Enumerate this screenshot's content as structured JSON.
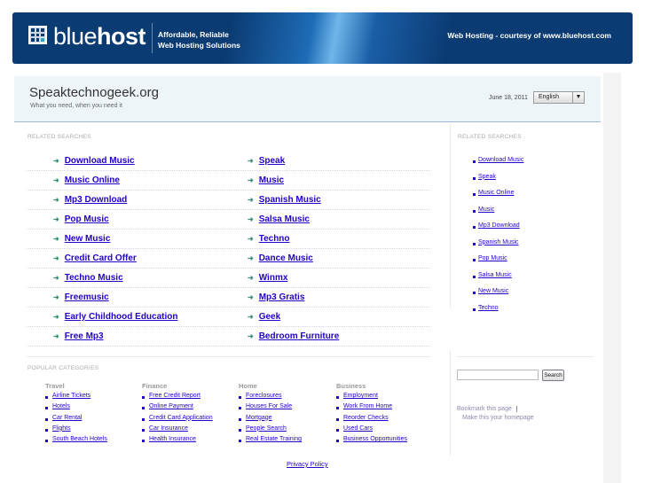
{
  "banner": {
    "logo_light": "blue",
    "logo_bold": "host",
    "tagline_1": "Affordable, Reliable",
    "tagline_2": "Web Hosting Solutions",
    "courtesy": "Web Hosting - courtesy of www.bluehost.com"
  },
  "header": {
    "title": "Speaktechnogeek.org",
    "subtitle": "What you need, when you need it",
    "date": "June 18, 2011",
    "language": "English"
  },
  "related": {
    "label": "RELATED SEARCHES",
    "left": [
      "Download Music",
      "Music Online",
      "Mp3 Download",
      "Pop Music",
      "New Music",
      "Credit Card Offer",
      "Techno Music",
      "Freemusic",
      "Early Childhood Education",
      "Free Mp3"
    ],
    "right": [
      "Speak",
      "Music",
      "Spanish Music",
      "Salsa Music",
      "Techno",
      "Dance Music",
      "Winmx",
      "Mp3 Gratis",
      "Geek",
      "Bedroom Furniture"
    ]
  },
  "sidebar": {
    "label": "RELATED SEARCHES",
    "items": [
      "Download Music",
      "Speak",
      "Music Online",
      "Music",
      "Mp3 Download",
      "Spanish Music",
      "Pop Music",
      "Salsa Music",
      "New Music",
      "Techno"
    ],
    "search_button": "Search",
    "search_value": "",
    "bookmark": "Bookmark this page",
    "homepage": "Make this your homepage"
  },
  "popular": {
    "label": "POPULAR CATEGORIES",
    "columns": [
      {
        "title": "Travel",
        "items": [
          "Airline Tickets",
          "Hotels",
          "Car Rental",
          "Flights",
          "South Beach Hotels"
        ]
      },
      {
        "title": "Finance",
        "items": [
          "Free Credit Report",
          "Online Payment",
          "Credit Card Application",
          "Car Insurance",
          "Health Insurance"
        ]
      },
      {
        "title": "Home",
        "items": [
          "Foreclosures",
          "Houses For Sale",
          "Mortgage",
          "People Search",
          "Real Estate Training"
        ]
      },
      {
        "title": "Business",
        "items": [
          "Employment",
          "Work From Home",
          "Reorder Checks",
          "Used Cars",
          "Business Opportunities"
        ]
      }
    ]
  },
  "footer": {
    "privacy": "Privacy Policy"
  }
}
